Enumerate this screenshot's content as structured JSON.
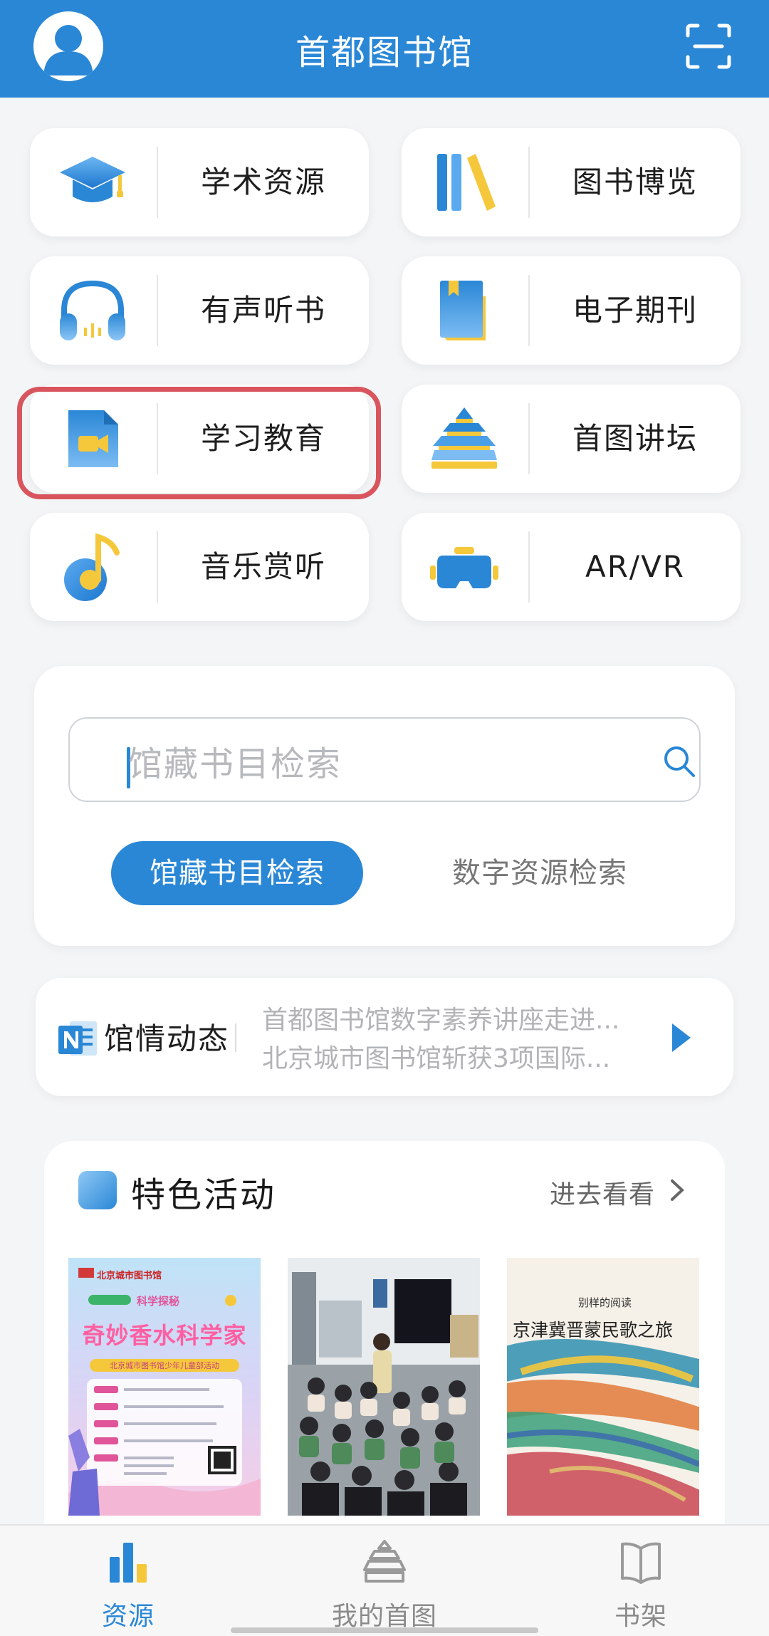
{
  "header": {
    "title": "首都图书馆",
    "icons": [
      "avatar-icon",
      "scan-icon"
    ]
  },
  "tiles": [
    {
      "label": "学术资源",
      "icon": "graduation-cap-icon"
    },
    {
      "label": "图书博览",
      "icon": "books-icon"
    },
    {
      "label": "有声听书",
      "icon": "headphones-icon"
    },
    {
      "label": "电子期刊",
      "icon": "bookmark-book-icon"
    },
    {
      "label": "学习教育",
      "icon": "video-camera-icon",
      "highlighted": true
    },
    {
      "label": "首图讲坛",
      "icon": "temple-icon"
    },
    {
      "label": "音乐赏听",
      "icon": "music-note-icon"
    },
    {
      "label": "AR/VR",
      "icon": "vr-headset-icon"
    }
  ],
  "search": {
    "placeholder": "馆藏书目检索",
    "tabs": [
      {
        "label": "馆藏书目检索",
        "active": true
      },
      {
        "label": "数字资源检索",
        "active": false
      }
    ]
  },
  "news": {
    "label": "馆情动态",
    "items": [
      "首都图书馆数字素养讲座走进...",
      "北京城市图书馆斩获3项国际..."
    ]
  },
  "activities": {
    "title": "特色活动",
    "more_label": "进去看看",
    "posters": [
      {
        "name": "poster-science",
        "header": "北京城市图书馆",
        "tag": "科学探秘",
        "title": "奇妙香水科学家",
        "subtitle": "北京城市图书馆少年儿童部活动"
      },
      {
        "name": "poster-classroom"
      },
      {
        "name": "poster-folk",
        "kicker": "别样的阅读",
        "title": "京津冀晋蒙民歌之旅"
      }
    ]
  },
  "tabbar": [
    {
      "label": "资源",
      "active": true,
      "icon": "bar-chart-icon"
    },
    {
      "label": "我的首图",
      "active": false,
      "icon": "temple-outline-icon"
    },
    {
      "label": "书架",
      "active": false,
      "icon": "open-book-icon"
    }
  ],
  "colors": {
    "brand": "#2a87d6",
    "highlight": "#d9555e",
    "icon_yellow": "#f5c83c"
  }
}
